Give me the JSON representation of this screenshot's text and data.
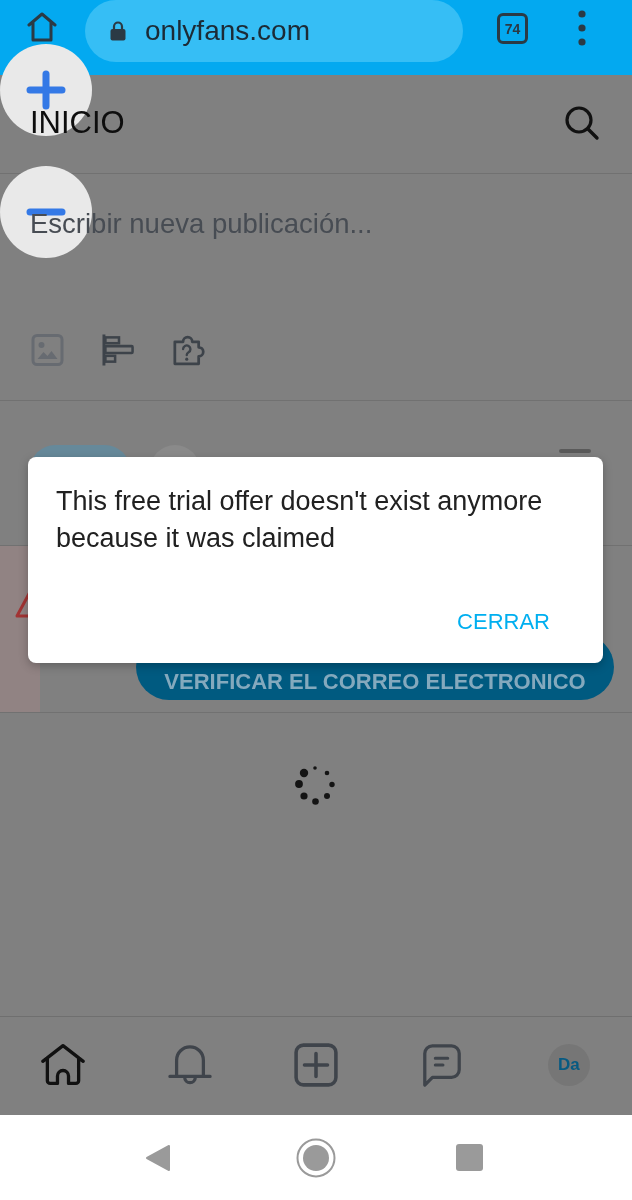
{
  "browser": {
    "url": "onlyfans.com",
    "tab_count": "74"
  },
  "header": {
    "title": "INICIO"
  },
  "composer": {
    "placeholder": "Escribir nueva publicación...",
    "tools": [
      {
        "kind": "image",
        "disabled": true
      },
      {
        "kind": "poll",
        "disabled": false
      },
      {
        "kind": "quiz",
        "disabled": false
      }
    ]
  },
  "verify_button": {
    "label": "VERIFICAR EL CORREO ELECTRONICO"
  },
  "dialog": {
    "message": "This free trial offer doesn't exist anymore because it was claimed",
    "button": "CERRAR"
  },
  "bottom_nav": [
    {
      "kind": "home",
      "selected": true
    },
    {
      "kind": "notifications",
      "selected": false
    },
    {
      "kind": "new_post",
      "selected": false
    },
    {
      "kind": "messages",
      "selected": false
    },
    {
      "kind": "profile",
      "label": "Da",
      "selected": false
    }
  ]
}
